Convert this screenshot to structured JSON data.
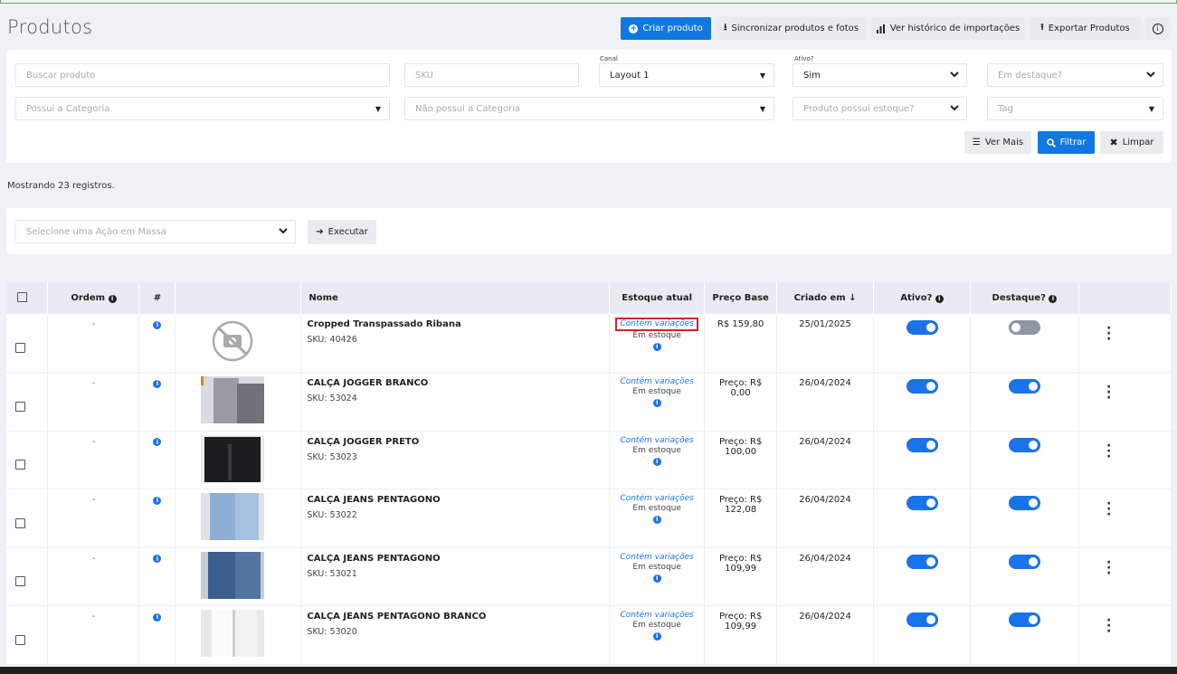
{
  "page": {
    "title": "Produtos"
  },
  "toolbar": {
    "create_label": "Criar produto",
    "sync_label": "Sincronizar produtos e fotos",
    "history_label": "Ver histórico de importações",
    "export_label": "Exportar Produtos"
  },
  "filters": {
    "search_placeholder": "Buscar produto",
    "sku_placeholder": "SKU",
    "channel_label": "Canal",
    "channel_value": "Layout 1",
    "active_label": "Ativo?",
    "active_value": "Sim",
    "featured_placeholder": "Em destaque?",
    "has_category_placeholder": "Possui a Categoria",
    "no_category_placeholder": "Não possui a Categoria",
    "has_stock_placeholder": "Produto possui estoque?",
    "tag_placeholder": "Tag",
    "more_label": "Ver Mais",
    "filter_label": "Filtrar",
    "clear_label": "Limpar"
  },
  "summary": "Mostrando 23 registros.",
  "bulk": {
    "select_placeholder": "Selecione uma Ação em Massa",
    "execute_label": "Executar"
  },
  "table": {
    "headers": {
      "order": "Ordem",
      "hash": "#",
      "name": "Nome",
      "stock": "Estoque atual",
      "base_price": "Preço Base",
      "created": "Criado em",
      "active": "Ativo?",
      "featured": "Destaque?"
    },
    "rows": [
      {
        "order": "-",
        "name": "Cropped Transpassado Ribana",
        "sku": "SKU: 40426",
        "variations": "Contém variações",
        "stock": "Em estoque",
        "price": "R$ 159,80",
        "created": "25/01/2025",
        "active": true,
        "featured": false
      },
      {
        "order": "-",
        "name": "CALÇA JOGGER BRANCO",
        "sku": "SKU: 53024",
        "variations": "Contém variações",
        "stock": "Em estoque",
        "price": "Preço: R$ 0,00",
        "created": "26/04/2024",
        "active": true,
        "featured": true
      },
      {
        "order": "-",
        "name": "CALÇA JOGGER PRETO",
        "sku": "SKU: 53023",
        "variations": "Contém variações",
        "stock": "Em estoque",
        "price": "Preço: R$ 100,00",
        "created": "26/04/2024",
        "active": true,
        "featured": true
      },
      {
        "order": "-",
        "name": "CALÇA JEANS PENTAGONO",
        "sku": "SKU: 53022",
        "variations": "Contém variações",
        "stock": "Em estoque",
        "price": "Preço: R$ 122,08",
        "created": "26/04/2024",
        "active": true,
        "featured": true
      },
      {
        "order": "-",
        "name": "CALÇA JEANS PENTAGONO",
        "sku": "SKU: 53021",
        "variations": "Contém variações",
        "stock": "Em estoque",
        "price": "Preço: R$ 109,99",
        "created": "26/04/2024",
        "active": true,
        "featured": true
      },
      {
        "order": "-",
        "name": "CALÇA JEANS PENTAGONO BRANCO",
        "sku": "SKU: 53020",
        "variations": "Contém variações",
        "stock": "Em estoque",
        "price": "Preço: R$ 109,99",
        "created": "26/04/2024",
        "active": true,
        "featured": true
      }
    ]
  },
  "colors": {
    "primary": "#1277e1",
    "highlight": "#d6212a",
    "toggle_on": "#1a73e8",
    "toggle_off": "#8e96a4"
  }
}
